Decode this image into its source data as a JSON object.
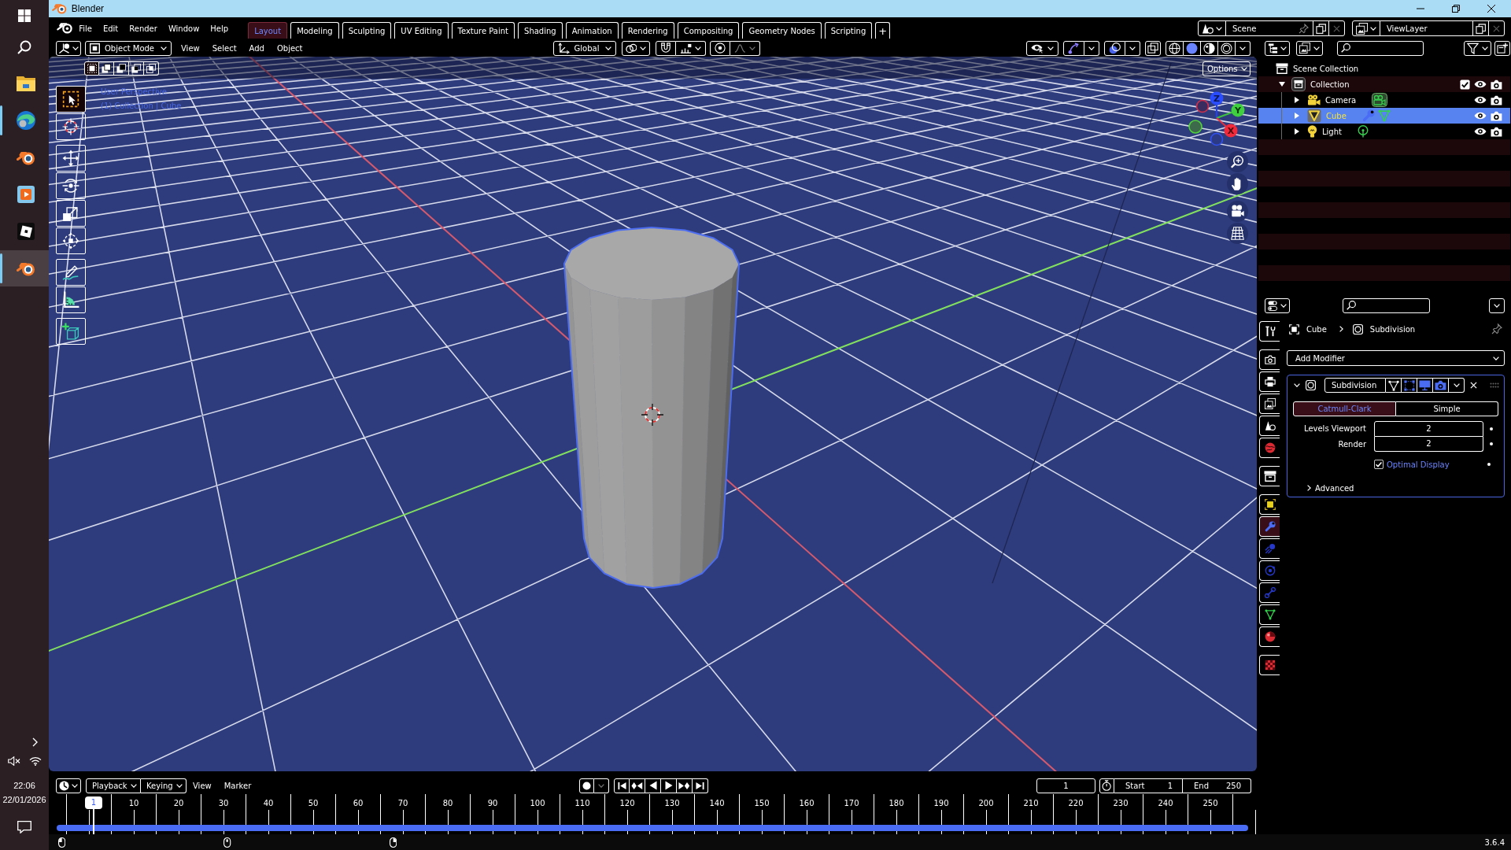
{
  "window": {
    "title": "Blender"
  },
  "taskbar": {
    "apps": [
      {
        "kind": "explorer",
        "running": false,
        "selected": false
      },
      {
        "kind": "edge",
        "running": true,
        "selected": false
      },
      {
        "kind": "blender",
        "running": false,
        "selected": false
      },
      {
        "kind": "player",
        "running": false,
        "selected": false
      },
      {
        "kind": "tiles",
        "running": false,
        "selected": false
      },
      {
        "kind": "blender",
        "running": true,
        "selected": true
      }
    ],
    "time": "22:06",
    "date": "22/01/2026"
  },
  "menubar": {
    "menus": [
      "File",
      "Edit",
      "Render",
      "Window",
      "Help"
    ],
    "workspaces": [
      {
        "label": "Layout",
        "selected": true
      },
      {
        "label": "Modeling",
        "selected": false
      },
      {
        "label": "Sculpting",
        "selected": false
      },
      {
        "label": "UV Editing",
        "selected": false
      },
      {
        "label": "Texture Paint",
        "selected": false
      },
      {
        "label": "Shading",
        "selected": false
      },
      {
        "label": "Animation",
        "selected": false
      },
      {
        "label": "Rendering",
        "selected": false
      },
      {
        "label": "Compositing",
        "selected": false
      },
      {
        "label": "Geometry Nodes",
        "selected": false
      },
      {
        "label": "Scripting",
        "selected": false
      }
    ],
    "add_workspace": "+",
    "scene": "Scene",
    "view_layer": "ViewLayer"
  },
  "viewport": {
    "mode": "Object Mode",
    "menus": [
      "View",
      "Select",
      "Add",
      "Object"
    ],
    "orientation": "Global",
    "select_modes": [
      {
        "kind": "set",
        "selected": true
      },
      {
        "kind": "extend",
        "selected": false
      },
      {
        "kind": "subtract",
        "selected": false
      },
      {
        "kind": "invert",
        "selected": false
      },
      {
        "kind": "intersect",
        "selected": false
      }
    ],
    "shading": [
      {
        "kind": "wireframe",
        "selected": false
      },
      {
        "kind": "solid",
        "selected": true
      },
      {
        "kind": "material",
        "selected": false
      },
      {
        "kind": "rendered",
        "selected": false
      }
    ],
    "options": "Options",
    "info": [
      "User Perspective",
      "(1) Collection | Cube"
    ],
    "gizmo_axes": [
      "Z",
      "Y",
      "X"
    ],
    "tool_groups": [
      [
        {
          "kind": "select_box",
          "selected": true
        },
        {
          "kind": "cursor",
          "selected": false
        }
      ],
      [
        {
          "kind": "move",
          "selected": false
        },
        {
          "kind": "rotate",
          "selected": false
        },
        {
          "kind": "scale",
          "selected": false
        },
        {
          "kind": "transform",
          "selected": false
        }
      ],
      [
        {
          "kind": "annotate",
          "selected": false
        },
        {
          "kind": "measure",
          "selected": false
        }
      ],
      [
        {
          "kind": "add_cube",
          "selected": false
        }
      ]
    ]
  },
  "outliner": {
    "tree": [
      {
        "name": "Scene Collection",
        "kind": "scene_collection",
        "children": [
          {
            "name": "Collection",
            "kind": "collection",
            "expanded": true,
            "checked": true,
            "selected": false,
            "children": [
              {
                "name": "Camera",
                "kind": "camera",
                "expanded": false,
                "selected": false
              },
              {
                "name": "Cube",
                "kind": "mesh",
                "expanded": false,
                "selected": true
              },
              {
                "name": "Light",
                "kind": "light",
                "expanded": false,
                "selected": false
              }
            ]
          }
        ]
      }
    ]
  },
  "properties": {
    "tab_groups": [
      [
        {
          "kind": "tool",
          "selected": false
        }
      ],
      [
        {
          "kind": "render",
          "selected": false
        },
        {
          "kind": "output",
          "selected": false
        },
        {
          "kind": "view_layer",
          "selected": false
        },
        {
          "kind": "scene",
          "selected": false
        },
        {
          "kind": "world",
          "selected": false
        }
      ],
      [
        {
          "kind": "collection",
          "selected": false
        }
      ],
      [
        {
          "kind": "object",
          "selected": false
        },
        {
          "kind": "modifiers",
          "selected": true
        },
        {
          "kind": "particles",
          "selected": false
        },
        {
          "kind": "physics",
          "selected": false
        },
        {
          "kind": "constraints",
          "selected": false
        },
        {
          "kind": "data",
          "selected": false
        },
        {
          "kind": "material",
          "selected": false
        }
      ],
      [
        {
          "kind": "texture",
          "selected": false
        }
      ]
    ],
    "breadcrumb": [
      "Cube",
      "Subdivision"
    ],
    "add_modifier": "Add Modifier",
    "modifier": {
      "name": "Subdivision",
      "expanded": true,
      "types": [
        {
          "label": "Catmull-Clark",
          "selected": true
        },
        {
          "label": "Simple",
          "selected": false
        }
      ],
      "fields": [
        {
          "label": "Levels Viewport",
          "value": "2"
        },
        {
          "label": "Render",
          "value": "2"
        }
      ],
      "optimal_display": {
        "label": "Optimal Display",
        "checked": true
      },
      "advanced": {
        "label": "Advanced",
        "expanded": false
      }
    }
  },
  "timeline": {
    "menus": [
      {
        "label": "Playback",
        "kind": "dropdown"
      },
      {
        "label": "Keying",
        "kind": "dropdown"
      },
      {
        "label": "View",
        "kind": "menu"
      },
      {
        "label": "Marker",
        "kind": "menu"
      }
    ],
    "current_frame": "1",
    "range": [
      {
        "label": "Start",
        "value": "1"
      },
      {
        "label": "End",
        "value": "250"
      }
    ],
    "playhead": "1",
    "frame_labels": [
      "10",
      "20",
      "30",
      "40",
      "50",
      "60",
      "70",
      "80",
      "90",
      "100",
      "110",
      "120",
      "130",
      "140",
      "150",
      "160",
      "170",
      "180",
      "190",
      "200",
      "210",
      "220",
      "230",
      "240",
      "250"
    ]
  },
  "status_bar": {
    "version": "3.6.4"
  }
}
